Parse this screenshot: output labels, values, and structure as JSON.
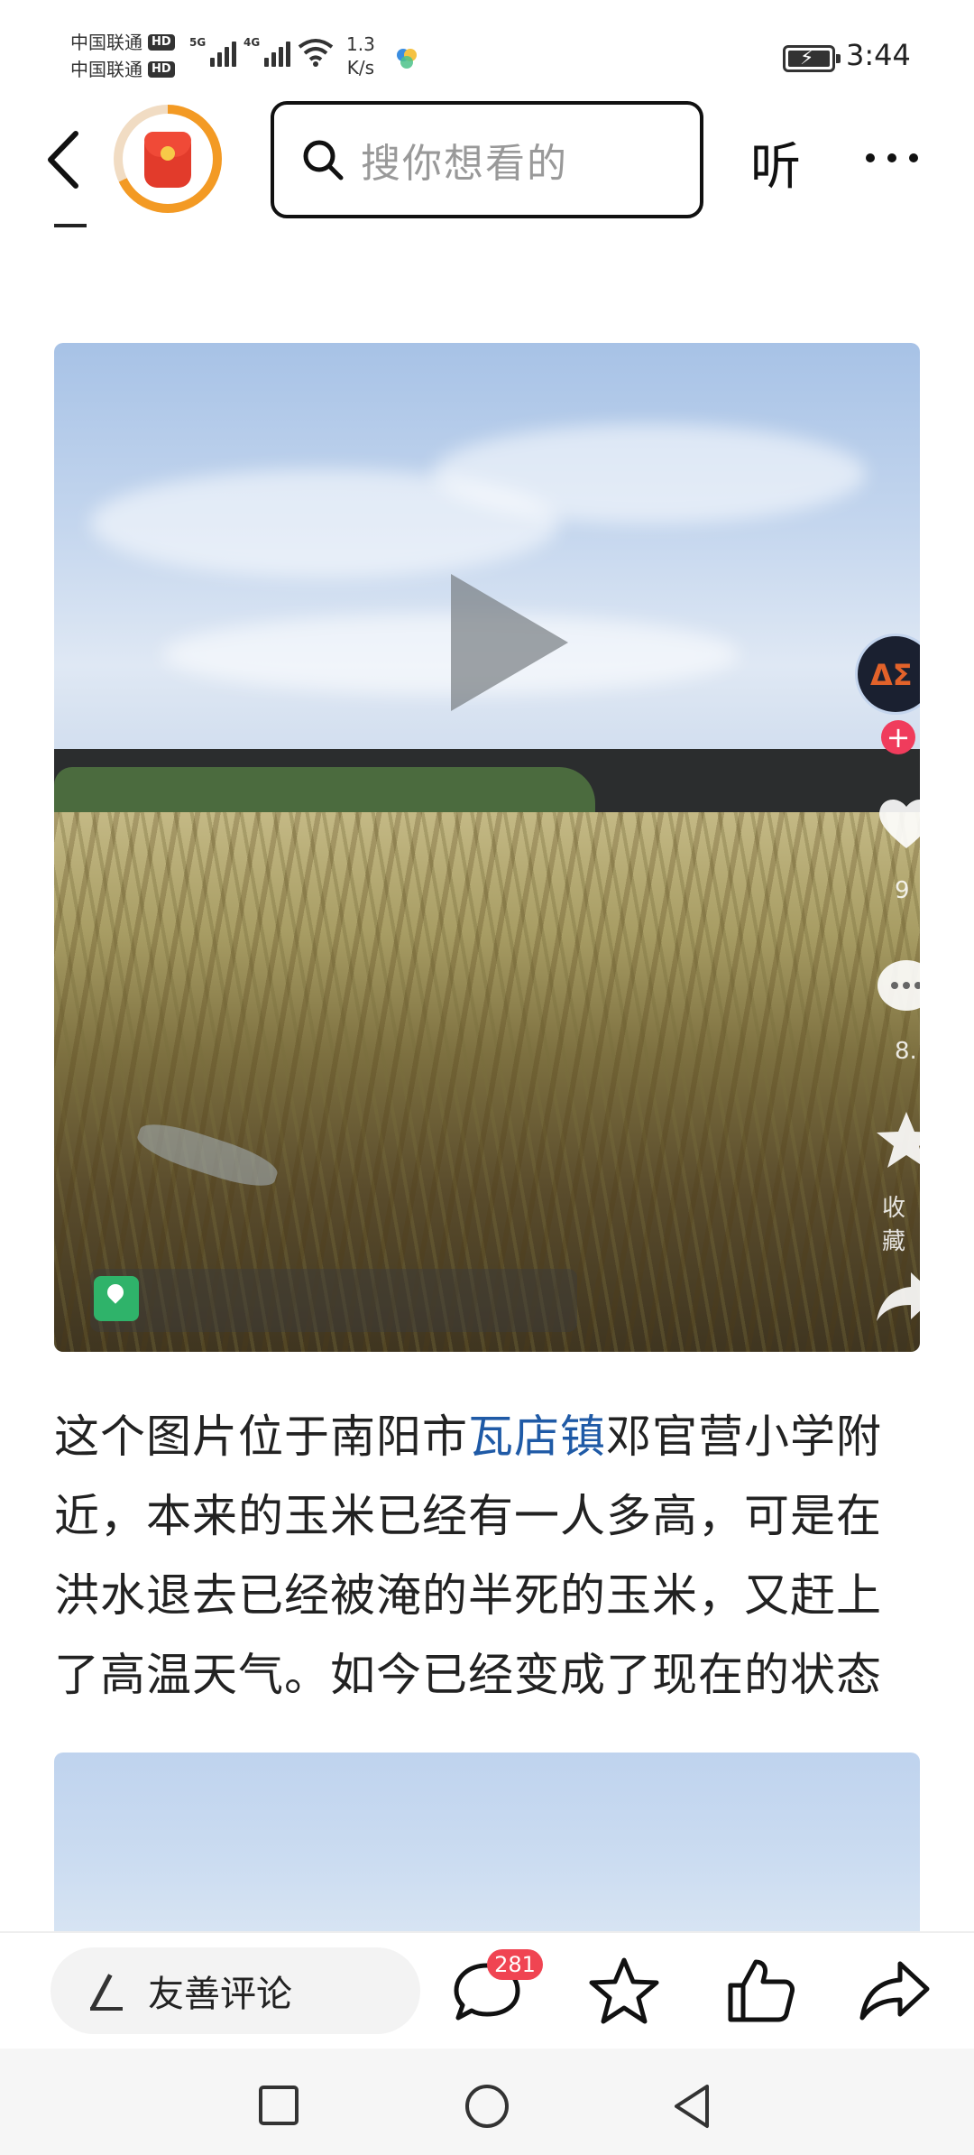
{
  "status_bar": {
    "carrier_1": "中国联通",
    "carrier_2": "中国联通",
    "hd_badge": "HD",
    "signal_1_label": "5G",
    "signal_2_label": "4G",
    "net_speed_value": "1.3",
    "net_speed_unit": "K/s",
    "time": "3:44"
  },
  "top_nav": {
    "search_placeholder": "搜你想看的",
    "listen_label": "听",
    "icons": [
      "back-chevron-icon",
      "red-packet-icon",
      "search-icon",
      "more-dots-icon"
    ]
  },
  "article": {
    "video_overlay": {
      "side_favorite_label": "收藏",
      "side_like_count_partial": "9",
      "side_comment_count_partial": "8."
    },
    "paragraph_before_link": "这个图片位于南阳市",
    "paragraph_link": "瓦店镇",
    "paragraph_after_link": "邓官营小学附近，本来的玉米已经有一人多高，可是在洪水退去已经被淹的半死的玉米，又赶上了高温天气。如今已经变成了现在的状态"
  },
  "action_bar": {
    "comment_prompt": "友善评论",
    "comment_count": "281",
    "icons": [
      "pen-icon",
      "comment-icon",
      "favorite-star-icon",
      "like-thumb-icon",
      "share-icon"
    ]
  },
  "colors": {
    "link": "#1f5aa6",
    "badge": "#f04452",
    "avatar_ring": "#f39a24"
  }
}
